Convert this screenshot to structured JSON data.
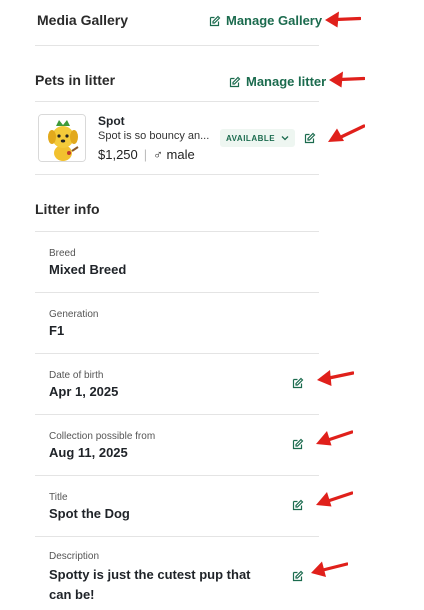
{
  "media_gallery": {
    "title": "Media Gallery",
    "manage_label": "Manage Gallery"
  },
  "pets_in_litter": {
    "title": "Pets in litter",
    "manage_label": "Manage litter",
    "pets": [
      {
        "name": "Spot",
        "description": "Spot is so bouncy an...",
        "price": "$1,250",
        "sex_icon": "♂",
        "sex": "male",
        "status": "AVAILABLE"
      }
    ]
  },
  "litter_info": {
    "title": "Litter info",
    "fields": [
      {
        "label": "Breed",
        "value": "Mixed Breed",
        "editable": false
      },
      {
        "label": "Generation",
        "value": "F1",
        "editable": false
      },
      {
        "label": "Date of birth",
        "value": "Apr 1, 2025",
        "editable": true
      },
      {
        "label": "Collection possible from",
        "value": "Aug 11, 2025",
        "editable": true
      },
      {
        "label": "Title",
        "value": "Spot the Dog",
        "editable": true
      },
      {
        "label": "Description",
        "value_line1": "Spotty is just the cutest pup that",
        "value_line2": "can be!",
        "editable": true
      }
    ]
  },
  "colors": {
    "accent": "#1b6b4e",
    "badge_bg": "#eef6f1",
    "divider": "#e4e4e4",
    "arrow": "#e0201b"
  },
  "icons": {
    "edit": "edit-icon",
    "arrow": "red-arrow-annotation",
    "chevron": "chevron-down-icon"
  }
}
